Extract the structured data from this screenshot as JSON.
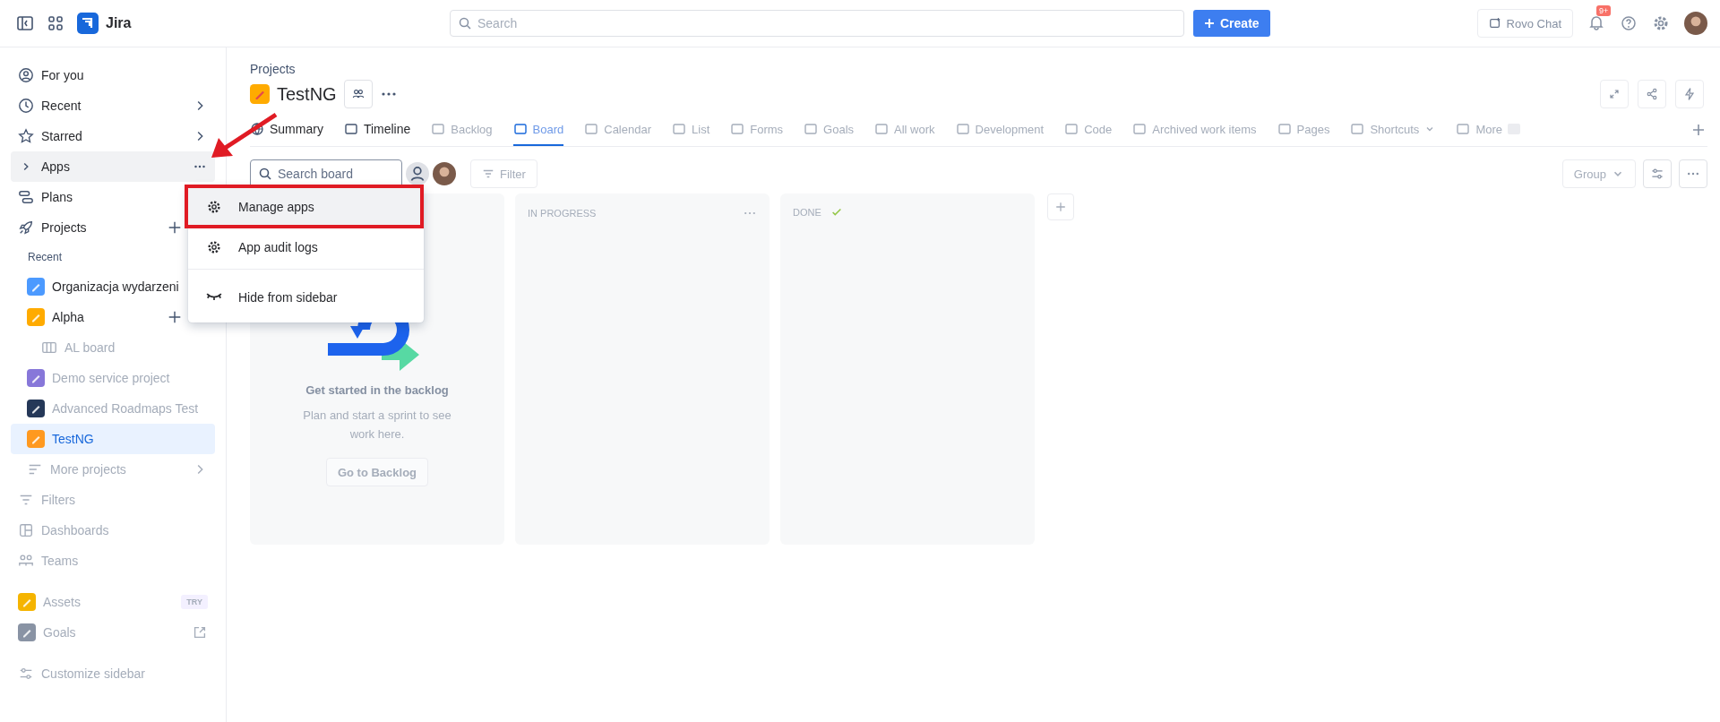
{
  "topbar": {
    "product": "Jira",
    "search": {
      "placeholder": "Search"
    },
    "create_label": "Create",
    "rovo_label": "Rovo Chat",
    "notification_count": "9+",
    "blurred": true
  },
  "sidebar": {
    "items": [
      {
        "kind": "nav",
        "label": "For you",
        "selected": false,
        "menu_open": false,
        "blurred": false
      },
      {
        "kind": "nav",
        "label": "Recent",
        "selected": false,
        "menu_open": false,
        "blurred": false
      },
      {
        "kind": "nav",
        "label": "Starred",
        "selected": false,
        "menu_open": false,
        "blurred": false
      },
      {
        "kind": "nav",
        "label": "Apps",
        "selected": false,
        "menu_open": true,
        "blurred": false
      },
      {
        "kind": "nav",
        "label": "Plans",
        "selected": false,
        "menu_open": false,
        "blurred": false
      },
      {
        "kind": "nav",
        "label": "Projects",
        "selected": false,
        "menu_open": false,
        "blurred": false
      },
      {
        "kind": "heading",
        "label": "Recent",
        "selected": false,
        "menu_open": false,
        "blurred": false
      },
      {
        "kind": "project",
        "label": "Organizacja wydarzeni",
        "color": "#4c9aff",
        "selected": false,
        "menu_open": false,
        "blurred": false
      },
      {
        "kind": "project",
        "label": "Alpha",
        "color": "#ffab00",
        "selected": false,
        "menu_open": false,
        "blurred": false
      },
      {
        "kind": "board",
        "label": "AL board",
        "selected": false,
        "menu_open": false,
        "blurred": true
      },
      {
        "kind": "project",
        "label": "Demo service project",
        "color": "#8777d9",
        "selected": false,
        "menu_open": false,
        "blurred": true
      },
      {
        "kind": "project",
        "label": "Advanced Roadmaps Test",
        "color": "#253858",
        "selected": false,
        "menu_open": false,
        "blurred": true
      },
      {
        "kind": "project",
        "label": "TestNG",
        "color": "#ff991f",
        "selected": true,
        "menu_open": false,
        "blurred": true
      },
      {
        "kind": "more",
        "label": "More projects",
        "selected": false,
        "menu_open": false,
        "blurred": true
      },
      {
        "kind": "nav",
        "label": "Filters",
        "selected": false,
        "menu_open": false,
        "blurred": true
      },
      {
        "kind": "nav",
        "label": "Dashboards",
        "selected": false,
        "menu_open": false,
        "blurred": true
      },
      {
        "kind": "nav",
        "label": "Teams",
        "selected": false,
        "menu_open": false,
        "blurred": true
      },
      {
        "kind": "app",
        "label": "Assets",
        "color": "#f5b400",
        "badge": "TRY",
        "selected": false,
        "menu_open": false,
        "blurred": true
      },
      {
        "kind": "app",
        "label": "Goals",
        "color": "#8993a4",
        "selected": false,
        "menu_open": false,
        "blurred": true
      },
      {
        "kind": "footer",
        "label": "Customize sidebar",
        "selected": false,
        "menu_open": false,
        "blurred": true
      }
    ]
  },
  "menu": {
    "items": [
      {
        "label": "Manage apps",
        "selected": true
      },
      {
        "label": "App audit logs",
        "selected": false
      },
      {
        "label": "Hide from sidebar",
        "selected": false
      }
    ]
  },
  "header": {
    "breadcrumb": "Projects",
    "title": "TestNG"
  },
  "tabs": [
    {
      "label": "Summary",
      "selected": false,
      "blurred": false
    },
    {
      "label": "Timeline",
      "selected": false,
      "blurred": false
    },
    {
      "label": "Backlog",
      "selected": false,
      "blurred": true
    },
    {
      "label": "Board",
      "selected": true,
      "blurred": true
    },
    {
      "label": "Calendar",
      "selected": false,
      "blurred": true
    },
    {
      "label": "List",
      "selected": false,
      "blurred": true
    },
    {
      "label": "Forms",
      "selected": false,
      "blurred": true
    },
    {
      "label": "Goals",
      "selected": false,
      "blurred": true
    },
    {
      "label": "All work",
      "selected": false,
      "blurred": true
    },
    {
      "label": "Development",
      "selected": false,
      "blurred": true
    },
    {
      "label": "Code",
      "selected": false,
      "blurred": true
    },
    {
      "label": "Archived work items",
      "selected": false,
      "blurred": true
    },
    {
      "label": "Pages",
      "selected": false,
      "blurred": true
    },
    {
      "label": "Shortcuts",
      "selected": false,
      "blurred": true
    },
    {
      "label": "More",
      "selected": false,
      "blurred": true
    }
  ],
  "board": {
    "search": {
      "placeholder": "Search board"
    },
    "filter_label": "Filter",
    "group_label": "Group",
    "empty_state": {
      "title": "Get started in the backlog",
      "text": "Plan and start a sprint to see work here.",
      "button": "Go to Backlog"
    },
    "columns": [
      {
        "title": "IN PROGRESS",
        "done": false
      },
      {
        "title": "DONE",
        "done": true
      }
    ]
  }
}
